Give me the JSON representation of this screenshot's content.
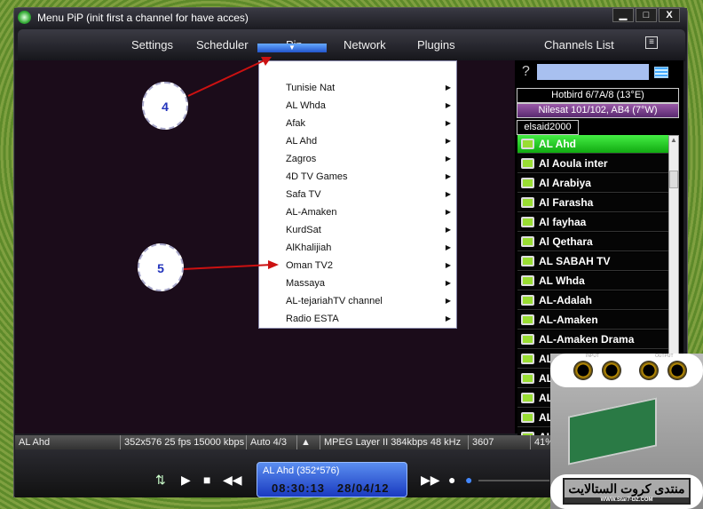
{
  "window": {
    "title": "Menu PiP (init first a channel for have acces)",
    "controls": [
      "▁",
      "□",
      "X"
    ]
  },
  "menu": {
    "items": [
      "Settings",
      "Scheduler",
      "Pip",
      "Network",
      "Plugins",
      "Channels List"
    ],
    "selected": "Pip"
  },
  "pip_menu": [
    "Tunisie Nat",
    "AL Whda",
    "Afak",
    "AL Ahd",
    "Zagros",
    "4D TV Games",
    "Safa TV",
    "AL-Amaken",
    "KurdSat",
    "AlKhalijiah",
    "Oman TV2",
    "Massaya",
    "AL-tejariahTV channel",
    "Radio ESTA"
  ],
  "callouts": [
    "4",
    "5"
  ],
  "channels_panel": {
    "help": "?",
    "search_value": "",
    "satellites": [
      "Hotbird 6/7A/8 (13°E)",
      "Nilesat 101/102, AB4 (7°W)"
    ],
    "group": "elsaid2000",
    "channels": [
      "AL Ahd",
      "Al Aoula inter",
      "Al Arabiya",
      "Al Farasha",
      "Al fayhaa",
      "Al Qethara",
      "AL SABAH TV",
      "AL Whda",
      "AL-Adalah",
      "AL-Amaken",
      "AL-Amaken Drama",
      "AL",
      "AL",
      "AL",
      "AL",
      "AL"
    ],
    "selected": "AL Ahd"
  },
  "status": {
    "channel": "AL Ahd",
    "video": "352x576 25 fps 15000 kbps",
    "aspect": "Auto 4/3",
    "audio": "MPEG Layer II 384kbps 48 kHz",
    "pid": "3607",
    "percent": "41%"
  },
  "display": {
    "line1": "AL Ahd (352*576)",
    "time": "08:30:13",
    "date": "28/04/12"
  },
  "ad": {
    "input": "INPUT",
    "output": "OUTPUT",
    "logo_text": "منتدى كروت الستالايت",
    "url": "WWW.Star7-DZ.COM"
  },
  "colors": {
    "selected_channel": "#33cc33",
    "accent": "#2255cc",
    "arrow": "#cc1111"
  }
}
